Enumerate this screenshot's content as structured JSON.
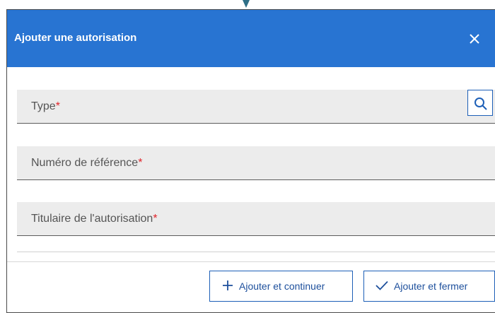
{
  "dialog": {
    "title": "Ajouter une autorisation",
    "close_icon": "close-icon",
    "accent_color": "#2874d2"
  },
  "fields": [
    {
      "label": "Type",
      "required": "*",
      "has_search": true,
      "search_icon": "search-icon"
    },
    {
      "label": "Numéro de référence",
      "required": "*"
    },
    {
      "label": "Titulaire de l'autorisation",
      "required": "*"
    }
  ],
  "footer": {
    "add_continue_label": "Ajouter et continuer",
    "add_continue_icon": "plus-icon",
    "add_close_label": "Ajouter et fermer",
    "add_close_icon": "check-icon"
  }
}
